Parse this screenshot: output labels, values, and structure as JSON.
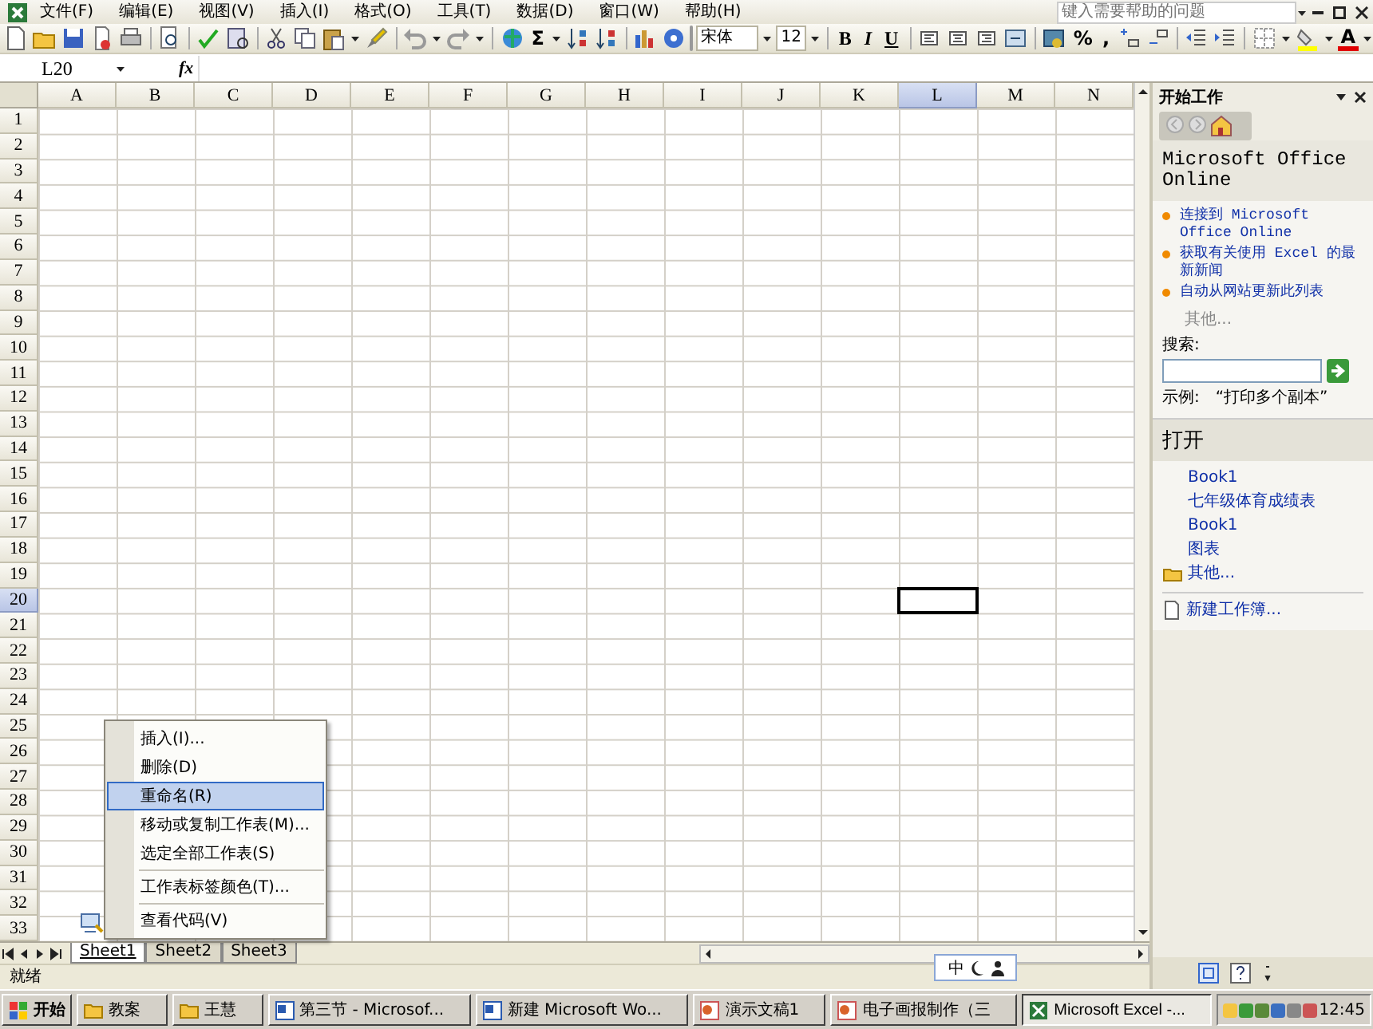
{
  "menu_bar": [
    "文件(F)",
    "编辑(E)",
    "视图(V)",
    "插入(I)",
    "格式(O)",
    "工具(T)",
    "数据(D)",
    "窗口(W)",
    "帮助(H)"
  ],
  "help_box": {
    "placeholder": "键入需要帮助的问题"
  },
  "standard_toolbar": {
    "autosum": "Σ"
  },
  "formatting_toolbar": {
    "font": "宋体",
    "size": "12",
    "style_buttons": [
      "B",
      "I",
      "U"
    ],
    "percent": "%",
    "comma": ",",
    "font_color": "A"
  },
  "formula_bar": {
    "name_box": "L20",
    "fx": "fx"
  },
  "grid": {
    "columns": [
      {
        "label": "A",
        "selected": false
      },
      {
        "label": "B",
        "selected": false
      },
      {
        "label": "C",
        "selected": false
      },
      {
        "label": "D",
        "selected": false
      },
      {
        "label": "E",
        "selected": false
      },
      {
        "label": "F",
        "selected": false
      },
      {
        "label": "G",
        "selected": false
      },
      {
        "label": "H",
        "selected": false
      },
      {
        "label": "I",
        "selected": false
      },
      {
        "label": "J",
        "selected": false
      },
      {
        "label": "K",
        "selected": false
      },
      {
        "label": "L",
        "selected": true
      },
      {
        "label": "M",
        "selected": false
      },
      {
        "label": "N",
        "selected": false
      }
    ],
    "rows": [
      {
        "label": "1",
        "selected": false
      },
      {
        "label": "2",
        "selected": false
      },
      {
        "label": "3",
        "selected": false
      },
      {
        "label": "4",
        "selected": false
      },
      {
        "label": "5",
        "selected": false
      },
      {
        "label": "6",
        "selected": false
      },
      {
        "label": "7",
        "selected": false
      },
      {
        "label": "8",
        "selected": false
      },
      {
        "label": "9",
        "selected": false
      },
      {
        "label": "10",
        "selected": false
      },
      {
        "label": "11",
        "selected": false
      },
      {
        "label": "12",
        "selected": false
      },
      {
        "label": "13",
        "selected": false
      },
      {
        "label": "14",
        "selected": false
      },
      {
        "label": "15",
        "selected": false
      },
      {
        "label": "16",
        "selected": false
      },
      {
        "label": "17",
        "selected": false
      },
      {
        "label": "18",
        "selected": false
      },
      {
        "label": "19",
        "selected": false
      },
      {
        "label": "20",
        "selected": true
      },
      {
        "label": "21",
        "selected": false
      },
      {
        "label": "22",
        "selected": false
      },
      {
        "label": "23",
        "selected": false
      },
      {
        "label": "24",
        "selected": false
      },
      {
        "label": "25",
        "selected": false
      },
      {
        "label": "26",
        "selected": false
      },
      {
        "label": "27",
        "selected": false
      },
      {
        "label": "28",
        "selected": false
      },
      {
        "label": "29",
        "selected": false
      },
      {
        "label": "30",
        "selected": false
      },
      {
        "label": "31",
        "selected": false
      },
      {
        "label": "32",
        "selected": false
      },
      {
        "label": "33",
        "selected": false
      }
    ]
  },
  "context_menu": [
    {
      "label": "插入(I)...",
      "kind": "item",
      "divider_above": false,
      "selected": false
    },
    {
      "label": "删除(D)",
      "kind": "item",
      "divider_above": false,
      "selected": false
    },
    {
      "label": "重命名(R)",
      "kind": "item",
      "divider_above": false,
      "selected": true
    },
    {
      "label": "移动或复制工作表(M)...",
      "kind": "item",
      "divider_above": false,
      "selected": false
    },
    {
      "label": "选定全部工作表(S)",
      "kind": "item",
      "divider_above": false,
      "selected": false
    },
    {
      "label": "工作表标签颜色(T)...",
      "kind": "item",
      "divider_above": true,
      "selected": false
    },
    {
      "label": "查看代码(V)",
      "kind": "code",
      "divider_above": true,
      "selected": false
    }
  ],
  "sheet_tabs": [
    {
      "label": "Sheet1",
      "selected": true
    },
    {
      "label": "Sheet2",
      "selected": false
    },
    {
      "label": "Sheet3",
      "selected": false
    }
  ],
  "status_bar": {
    "text": "就绪"
  },
  "ime_bar": {
    "mode": "中"
  },
  "task_pane": {
    "title": "开始工作",
    "online": {
      "heading": "Microsoft Office Online",
      "links": [
        "连接到 Microsoft Office Online",
        "获取有关使用 Excel 的最新新闻",
        "自动从网站更新此列表"
      ],
      "more": "其他...",
      "search_label": "搜索:",
      "example_label": "示例:",
      "example": "“打印多个副本”"
    },
    "open": {
      "heading": "打开",
      "files": [
        "Book1",
        "七年级体育成绩表",
        "Book1",
        "图表"
      ],
      "more": "其他...",
      "new_workbook": "新建工作簿..."
    }
  },
  "taskbar": {
    "start": "开始",
    "buttons": [
      {
        "label": "教案",
        "kind": "folder",
        "selected": false
      },
      {
        "label": "王慧",
        "kind": "folder",
        "selected": false
      },
      {
        "label": "第三节 - Microsof...",
        "kind": "word",
        "selected": false
      },
      {
        "label": "新建 Microsoft Wo...",
        "kind": "word",
        "selected": false
      },
      {
        "label": "演示文稿1",
        "kind": "powerpoint",
        "selected": false
      },
      {
        "label": "电子画报制作（三",
        "kind": "powerpoint",
        "selected": false
      },
      {
        "label": "Microsoft Excel -...",
        "kind": "excel",
        "selected": true
      }
    ],
    "clock": "12:45"
  }
}
